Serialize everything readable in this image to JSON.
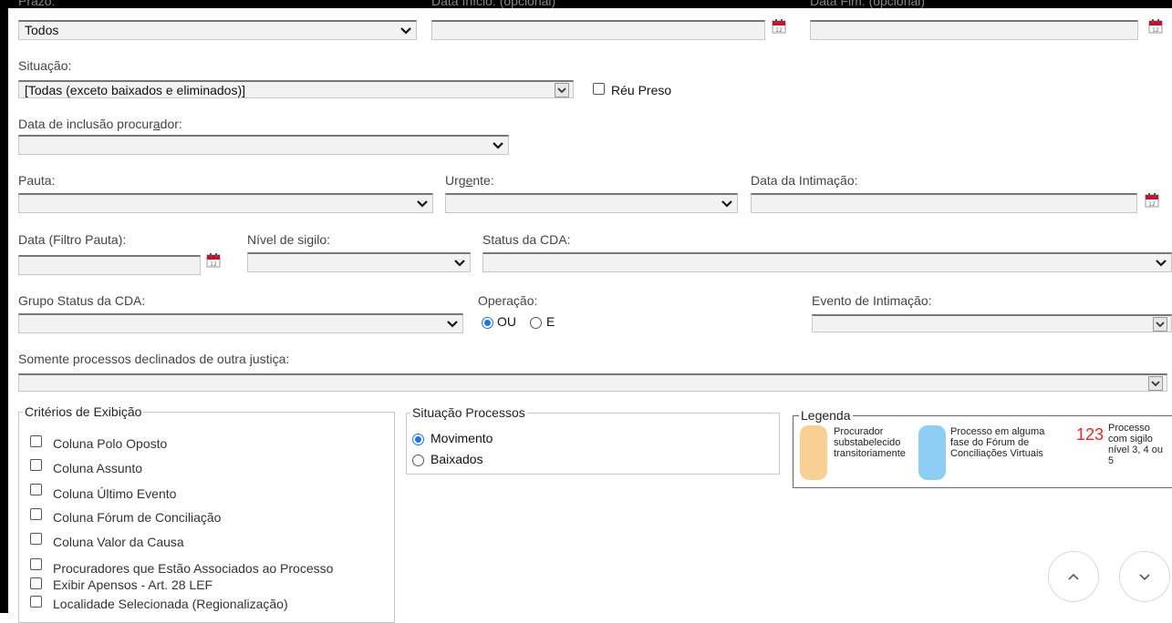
{
  "filters": {
    "prazo": {
      "label": "Prazo:",
      "value": "Todos"
    },
    "data_inicio": {
      "label": "Data Início: (opcional)"
    },
    "data_fim": {
      "label": "Data Fim: (opcional)"
    },
    "situacao": {
      "label": "Situação:",
      "value": "[Todas (exceto baixados e eliminados)]"
    },
    "reu_preso": {
      "label": "Réu Preso",
      "checked": false
    },
    "data_inclusao": {
      "label_prefix": "Data de inclusão procur",
      "label_accesskey": "a",
      "label_suffix": "dor:",
      "value": ""
    },
    "pauta": {
      "label": "Pauta:",
      "value": ""
    },
    "urgente": {
      "label_prefix": "Urg",
      "label_accesskey": "e",
      "label_suffix": "nte:",
      "value": ""
    },
    "data_intimacao": {
      "label": "Data da Intimação:"
    },
    "data_filtro_pauta": {
      "label": "Data (Filtro Pauta):"
    },
    "nivel_sigilo": {
      "label": "Nível de sigilo:",
      "value": ""
    },
    "status_cda": {
      "label": "Status da CDA:",
      "value": ""
    },
    "grupo_status_cda": {
      "label": "Grupo Status da CDA:",
      "value": ""
    },
    "operacao": {
      "label": "Operação:",
      "options": [
        "OU",
        "E"
      ],
      "selected": "OU"
    },
    "evento_intimacao": {
      "label": "Evento de Intimação:",
      "value": ""
    },
    "declinados": {
      "label": "Somente processos declinados de outra justiça:",
      "value": ""
    }
  },
  "criterios": {
    "title": "Critérios de Exibição",
    "items": [
      {
        "label": "Coluna Polo Oposto",
        "checked": false
      },
      {
        "label": "Coluna Assunto",
        "checked": false
      },
      {
        "label": "Coluna Último Evento",
        "checked": false
      },
      {
        "label": "Coluna Fórum de Conciliação",
        "checked": false
      },
      {
        "label": "Coluna Valor da Causa",
        "checked": false
      },
      {
        "label": "Procuradores que Estão Associados ao Processo",
        "checked": false
      },
      {
        "label": "Exibir Apensos - Art. 28 LEF",
        "checked": false
      },
      {
        "label": "Localidade Selecionada (Regionalização)",
        "checked": false
      }
    ]
  },
  "situacao_processos": {
    "title": "Situação Processos",
    "options": [
      "Movimento",
      "Baixados"
    ],
    "selected": "Movimento"
  },
  "legenda": {
    "title": "Legenda",
    "items": [
      {
        "swatch_color": "#f9cf93",
        "text": "Procurador substabelecido transitoriamente"
      },
      {
        "swatch_color": "#8ecdf4",
        "text": "Processo em alguma fase do Fórum de Conciliações Virtuais"
      },
      {
        "marker": "123",
        "marker_color": "#e0282f",
        "text": "Processo com sigilo nível 3, 4 ou 5"
      }
    ]
  },
  "scroll_buttons": {
    "up_icon": "chevron-up-icon",
    "down_icon": "chevron-down-icon"
  }
}
